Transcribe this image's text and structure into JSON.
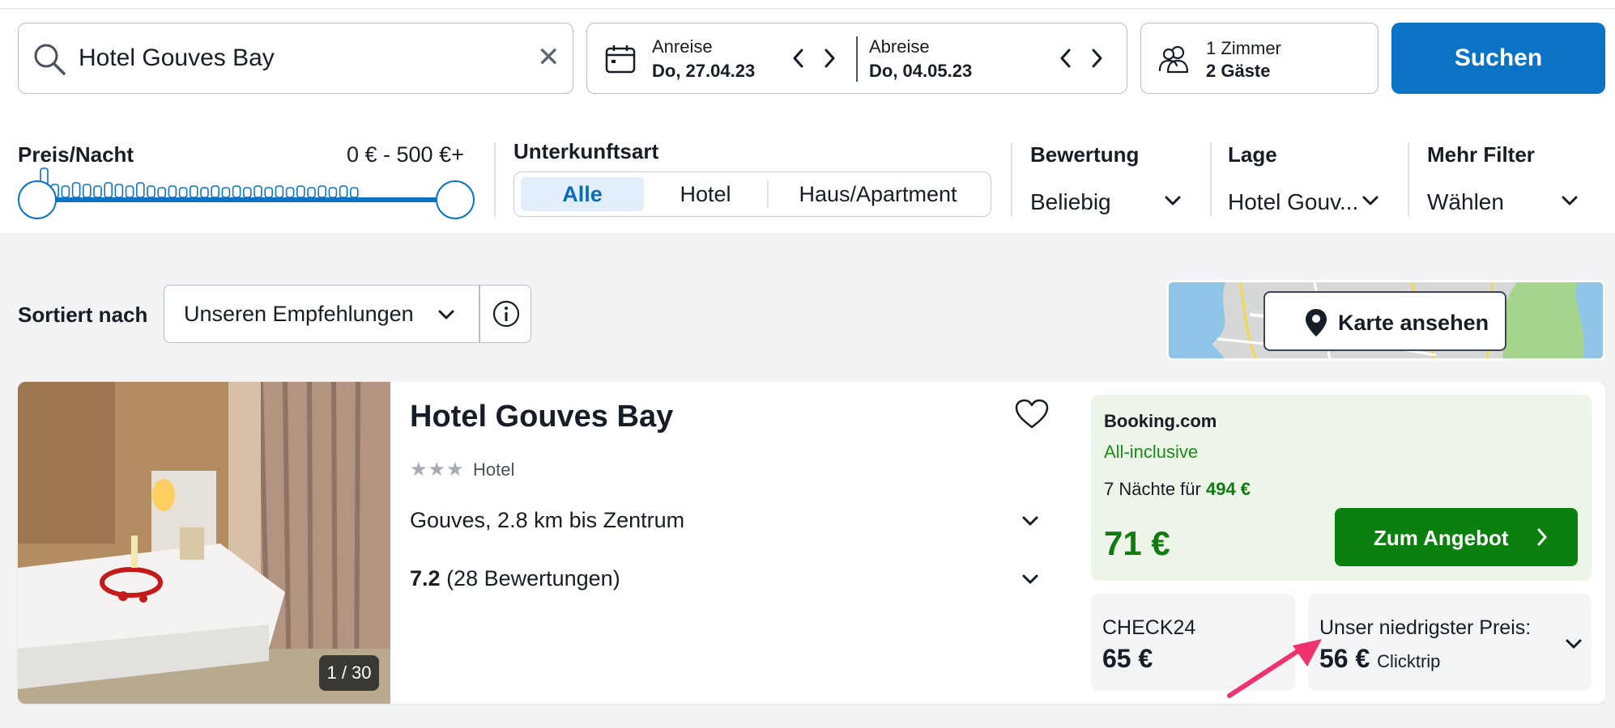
{
  "colors": {
    "primary_blue": "#0a73c5",
    "deal_green": "#117a11",
    "offer_button": "#0a800e",
    "annotation_pink": "#f0326e"
  },
  "search": {
    "value": "Hotel Gouves Bay",
    "clear_icon": "close-icon"
  },
  "dates": {
    "checkin_label": "Anreise",
    "checkin_value": "Do, 27.04.23",
    "checkout_label": "Abreise",
    "checkout_value": "Do, 04.05.23"
  },
  "guests": {
    "rooms": "1 Zimmer",
    "guests": "2 Gäste"
  },
  "search_button": "Suchen",
  "filters": {
    "price": {
      "title": "Preis/Nacht",
      "range": "0 € - 500 €+",
      "min_fraction": 0,
      "max_fraction": 1
    },
    "type": {
      "title": "Unterkunftsart",
      "options": [
        "Alle",
        "Hotel",
        "Haus/Apartment"
      ],
      "selected": "Alle"
    },
    "rating": {
      "title": "Bewertung",
      "value": "Beliebig"
    },
    "location": {
      "title": "Lage",
      "value": "Hotel Gouv..."
    },
    "more": {
      "title": "Mehr Filter",
      "value": "Wählen"
    }
  },
  "sort": {
    "label": "Sortiert nach",
    "value": "Unseren Empfehlungen"
  },
  "map": {
    "button_label": "Karte ansehen"
  },
  "hotel": {
    "name": "Hotel Gouves Bay",
    "stars": "★★★",
    "star_count": 3,
    "type": "Hotel",
    "location": "Gouves, 2.8 km bis Zentrum",
    "rating_score": "7.2",
    "rating_count": "(28 Bewertungen)",
    "photo_counter": "1 / 30",
    "best_deal": {
      "provider": "Booking.com",
      "board": "All-inclusive",
      "nights_text": "7 Nächte für",
      "total": "494 €",
      "price": "71 €",
      "button": "Zum Angebot"
    },
    "other_deals": [
      {
        "provider": "CHECK24",
        "price": "65 €"
      },
      {
        "label": "Unser niedrigster Preis:",
        "price": "56 €",
        "provider": "Clicktrip"
      }
    ]
  }
}
